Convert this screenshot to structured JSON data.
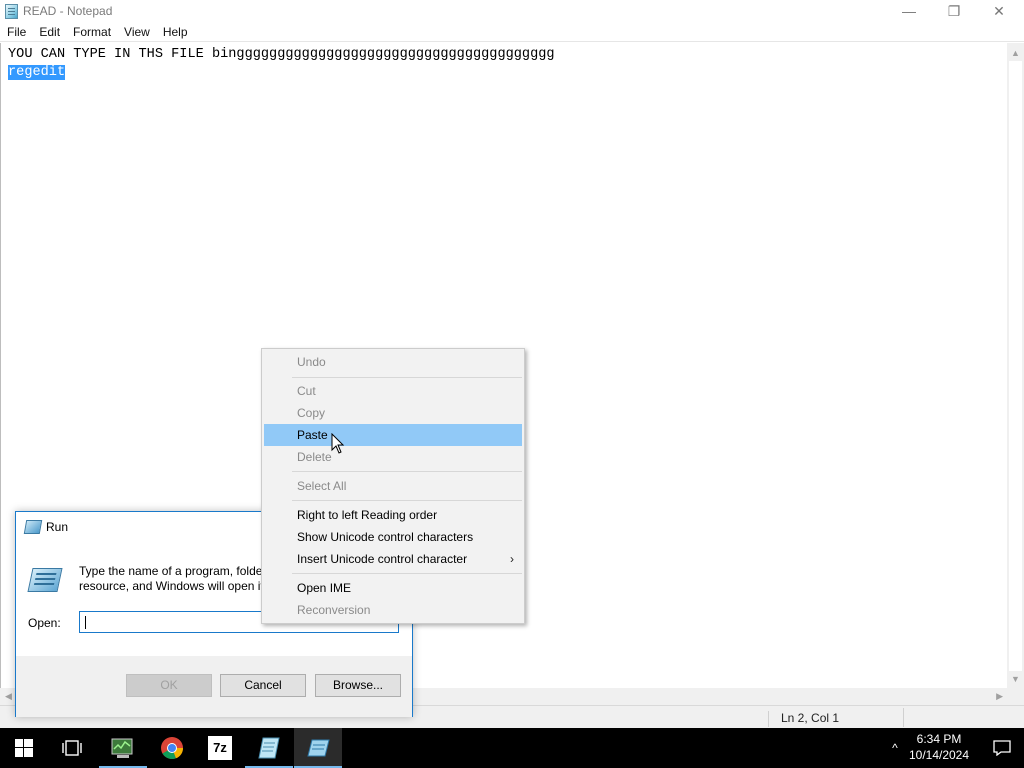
{
  "window": {
    "title": "READ - Notepad",
    "controls": {
      "minimize": "—",
      "maximize": "❐",
      "close": "✕"
    }
  },
  "menubar": {
    "items": [
      "File",
      "Edit",
      "Format",
      "View",
      "Help"
    ]
  },
  "editor": {
    "lines": [
      "YOU CAN TYPE IN THS FILE binggggggggggggggggggggggggggggggggggggggg",
      "regedit"
    ],
    "selected_text": "regedit"
  },
  "statusbar": {
    "position": "Ln 2, Col 1"
  },
  "run_dialog": {
    "title": "Run",
    "description_line1": "Type the name of a program, folde",
    "description_line2": "resource, and Windows will open it",
    "open_label": "Open:",
    "input_value": "",
    "buttons": {
      "ok": "OK",
      "cancel": "Cancel",
      "browse": "Browse..."
    }
  },
  "context_menu": {
    "items": [
      {
        "label": "Undo",
        "enabled": false
      },
      {
        "label": "Cut",
        "enabled": false
      },
      {
        "label": "Copy",
        "enabled": false
      },
      {
        "label": "Paste",
        "enabled": true,
        "highlighted": true
      },
      {
        "label": "Delete",
        "enabled": false
      },
      {
        "label": "Select All",
        "enabled": false
      },
      {
        "label": "Right to left Reading order",
        "enabled": true
      },
      {
        "label": "Show Unicode control characters",
        "enabled": true
      },
      {
        "label": "Insert Unicode control character",
        "enabled": true,
        "submenu": true
      },
      {
        "label": "Open IME",
        "enabled": true
      },
      {
        "label": "Reconversion",
        "enabled": false
      }
    ],
    "submenu_arrow": "›"
  },
  "taskbar": {
    "apps": [
      "start-icon",
      "task-view-icon",
      "task-manager-icon",
      "chrome-icon",
      "7zip-icon",
      "notepad-icon",
      "run-icon"
    ],
    "sevenzip_label": "7z",
    "tray_chevron": "^",
    "time": "6:34 PM",
    "date": "10/14/2024"
  },
  "colors": {
    "selection": "#3399ff",
    "menu_highlight": "#91c9f7",
    "accent": "#1979ca",
    "taskbar": "#000000"
  }
}
